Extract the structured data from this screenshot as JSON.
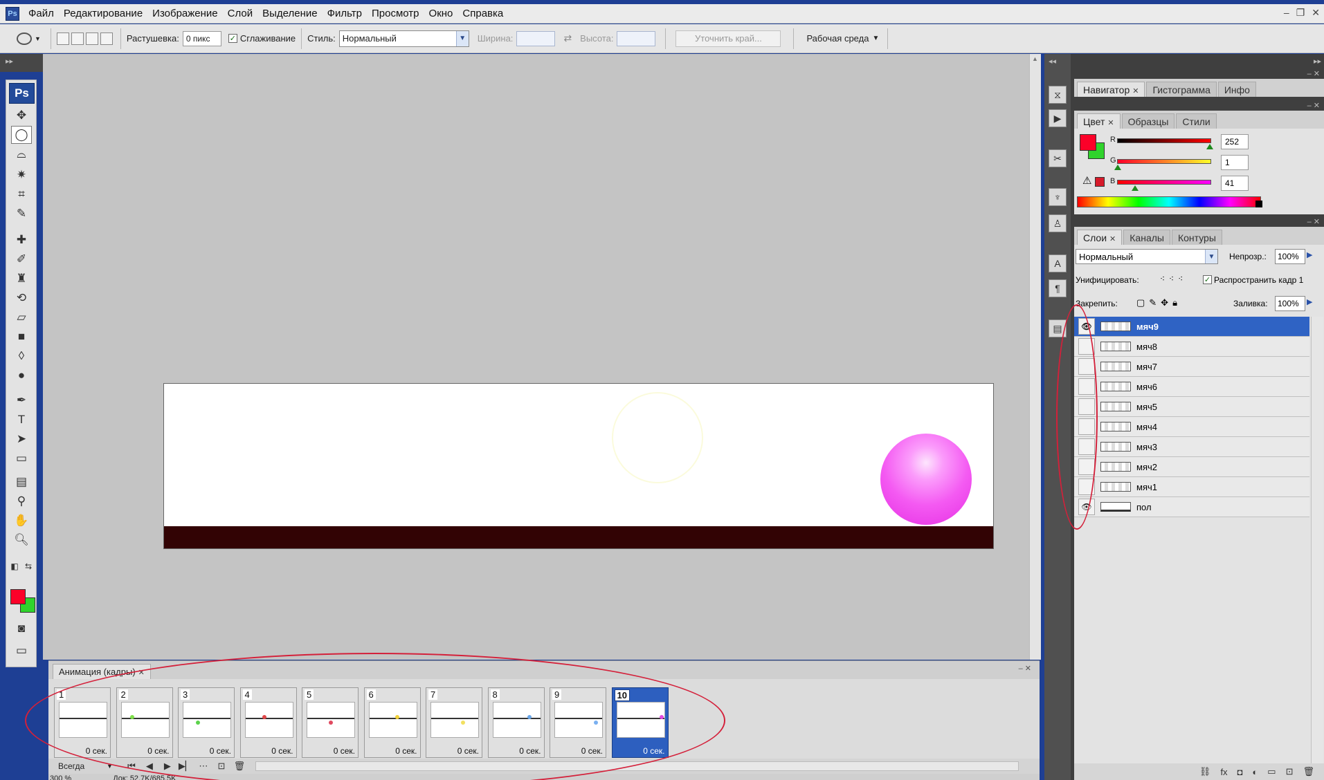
{
  "menubar": {
    "app_icon": "Ps",
    "items": [
      "Файл",
      "Редактирование",
      "Изображение",
      "Слой",
      "Выделение",
      "Фильтр",
      "Просмотр",
      "Окно",
      "Справка"
    ],
    "window_controls": [
      "–",
      "❐",
      "✕"
    ]
  },
  "options_bar": {
    "feather_label": "Растушевка:",
    "feather_value": "0 пикс",
    "antialias_label": "Сглаживание",
    "antialias_checked": true,
    "style_label": "Стиль:",
    "style_value": "Нормальный",
    "width_label": "Ширина:",
    "height_label": "Высота:",
    "refine_button": "Уточнить край...",
    "workspace_button": "Рабочая среда"
  },
  "toolbox": {
    "logo": "Ps",
    "icons": [
      "move-tool-icon",
      "ellipse-marquee-icon",
      "lasso-icon",
      "magic-wand-icon",
      "crop-icon",
      "slice-icon",
      "healing-brush-icon",
      "brush-icon",
      "clone-stamp-icon",
      "history-brush-icon",
      "eraser-icon",
      "gradient-icon",
      "blur-icon",
      "dodge-icon",
      "pen-icon",
      "type-icon",
      "path-select-icon",
      "shape-icon",
      "notes-icon",
      "eyedropper-icon",
      "hand-icon",
      "zoom-icon"
    ],
    "foreground_color": "#fc0129",
    "background_color": "#30d32c"
  },
  "navigator_panel": {
    "tabs": [
      "Навигатор",
      "Гистограмма",
      "Инфо"
    ]
  },
  "color_panel": {
    "tabs": [
      "Цвет",
      "Образцы",
      "Стили"
    ],
    "r_label": "R",
    "g_label": "G",
    "b_label": "B",
    "r_value": "252",
    "g_value": "1",
    "b_value": "41",
    "fg_color": "#fc0129",
    "bg_color": "#30d32c"
  },
  "layers_panel": {
    "tabs": [
      "Слои",
      "Каналы",
      "Контуры"
    ],
    "blend_mode": "Нормальный",
    "opacity_label": "Непрозр.:",
    "opacity_value": "100%",
    "unify_label": "Унифицировать:",
    "propagate_label": "Распространить кадр 1",
    "lock_label": "Закрепить:",
    "fill_label": "Заливка:",
    "fill_value": "100%",
    "layers": [
      {
        "name": "мяч9",
        "visible": true,
        "selected": true
      },
      {
        "name": "мяч8",
        "visible": false,
        "selected": false
      },
      {
        "name": "мяч7",
        "visible": false,
        "selected": false
      },
      {
        "name": "мяч6",
        "visible": false,
        "selected": false
      },
      {
        "name": "мяч5",
        "visible": false,
        "selected": false
      },
      {
        "name": "мяч4",
        "visible": false,
        "selected": false
      },
      {
        "name": "мяч3",
        "visible": false,
        "selected": false
      },
      {
        "name": "мяч2",
        "visible": false,
        "selected": false
      },
      {
        "name": "мяч1",
        "visible": false,
        "selected": false
      },
      {
        "name": "пол",
        "visible": true,
        "selected": false
      }
    ]
  },
  "animation_panel": {
    "tab": "Анимация (кадры)",
    "frames": [
      {
        "num": "1",
        "delay": "0 сек.",
        "dot_color": "",
        "selected": false
      },
      {
        "num": "2",
        "delay": "0 сек.",
        "dot_color": "#7ee04a",
        "selected": false
      },
      {
        "num": "3",
        "delay": "0 сек.",
        "dot_color": "#5cd24c",
        "selected": false
      },
      {
        "num": "4",
        "delay": "0 сек.",
        "dot_color": "#e0484a",
        "selected": false
      },
      {
        "num": "5",
        "delay": "0 сек.",
        "dot_color": "#e04a60",
        "selected": false
      },
      {
        "num": "6",
        "delay": "0 сек.",
        "dot_color": "#f2d23a",
        "selected": false
      },
      {
        "num": "7",
        "delay": "0 сек.",
        "dot_color": "#f2e060",
        "selected": false
      },
      {
        "num": "8",
        "delay": "0 сек.",
        "dot_color": "#6aa6e8",
        "selected": false
      },
      {
        "num": "9",
        "delay": "0 сек.",
        "dot_color": "#7ab0f0",
        "selected": false
      },
      {
        "num": "10",
        "delay": "0 сек.",
        "dot_color": "#e34ae0",
        "selected": true
      }
    ],
    "loop_value": "Всегда"
  },
  "status": {
    "zoom": "300 %",
    "doc_info": "Док: 52,7K/685,5K"
  }
}
